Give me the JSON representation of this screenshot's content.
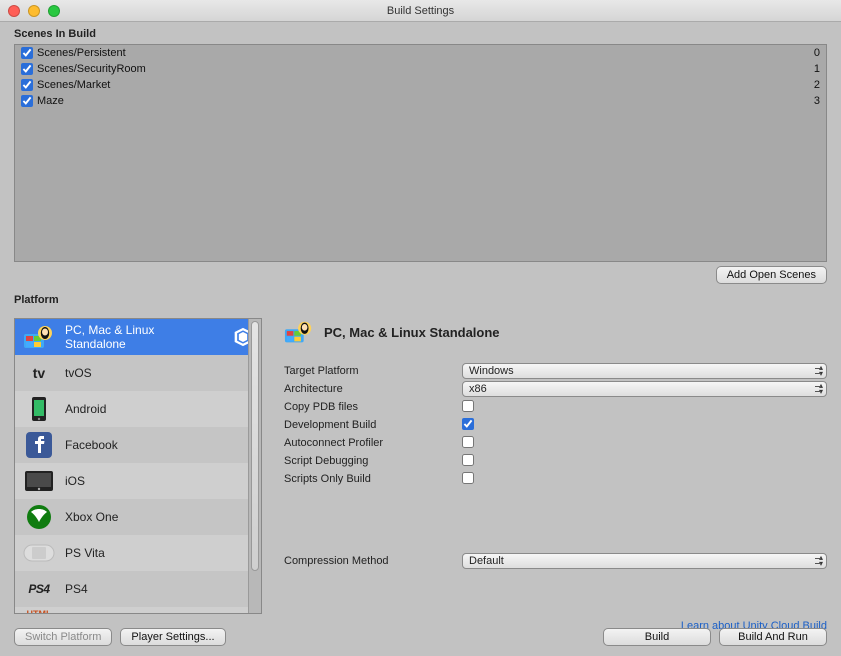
{
  "window": {
    "title": "Build Settings"
  },
  "scenes": {
    "heading": "Scenes In Build",
    "items": [
      {
        "checked": true,
        "name": "Scenes/Persistent",
        "index": "0"
      },
      {
        "checked": true,
        "name": "Scenes/SecurityRoom",
        "index": "1"
      },
      {
        "checked": true,
        "name": "Scenes/Market",
        "index": "2"
      },
      {
        "checked": true,
        "name": "Maze",
        "index": "3"
      }
    ],
    "add_button": "Add Open Scenes"
  },
  "platform": {
    "heading": "Platform",
    "items": [
      {
        "id": "standalone",
        "label": "PC, Mac & Linux Standalone",
        "selected": true,
        "active_badge": true
      },
      {
        "id": "tvos",
        "label": "tvOS"
      },
      {
        "id": "android",
        "label": "Android"
      },
      {
        "id": "facebook",
        "label": "Facebook"
      },
      {
        "id": "ios",
        "label": "iOS"
      },
      {
        "id": "xboxone",
        "label": "Xbox One"
      },
      {
        "id": "psvita",
        "label": "PS Vita"
      },
      {
        "id": "ps4",
        "label": "PS4"
      },
      {
        "id": "html5",
        "label": ""
      }
    ]
  },
  "details": {
    "title": "PC, Mac & Linux Standalone",
    "labels": {
      "target_platform": "Target Platform",
      "architecture": "Architecture",
      "copy_pdb": "Copy PDB files",
      "dev_build": "Development Build",
      "autoconnect": "Autoconnect Profiler",
      "script_debug": "Script Debugging",
      "scripts_only": "Scripts Only Build",
      "compression": "Compression Method"
    },
    "values": {
      "target_platform": "Windows",
      "architecture": "x86",
      "copy_pdb": false,
      "dev_build": true,
      "autoconnect": false,
      "script_debug": false,
      "scripts_only": false,
      "compression": "Default"
    },
    "link": "Learn about Unity Cloud Build"
  },
  "footer": {
    "switch_platform": "Switch Platform",
    "player_settings": "Player Settings...",
    "build": "Build",
    "build_and_run": "Build And Run"
  }
}
